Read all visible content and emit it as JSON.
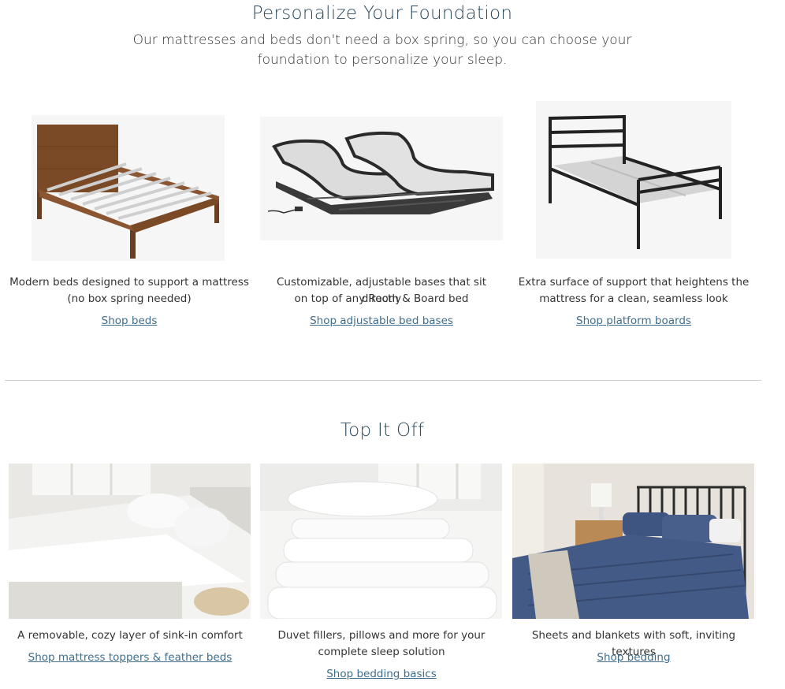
{
  "foundation": {
    "title": "Personalize Your Foundation",
    "subtitle": "Our mattresses and beds don't need a box spring, so you can choose your foundation to personalize your sleep.",
    "items": [
      {
        "desc_line1": "Modern beds designed to support a mattress",
        "desc_line2": "(no box spring needed)",
        "link": "Shop beds",
        "image_icon": "wood-bed-frame"
      },
      {
        "desc_line1": "Customizable, adjustable bases that sit directly",
        "desc_line2": "on top of any Room & Board bed",
        "link": "Shop adjustable bed bases",
        "image_icon": "adjustable-base"
      },
      {
        "desc_line1": "Extra surface of support that heightens the",
        "desc_line2": "mattress for a clean, seamless look",
        "link": "Shop platform boards",
        "image_icon": "metal-bed-frame"
      }
    ]
  },
  "top_it_off": {
    "title": "Top It Off",
    "items": [
      {
        "desc_line1": "A removable, cozy layer of sink-in comfort",
        "desc_line2": "",
        "link": "Shop mattress toppers & feather beds",
        "image_icon": "white-bedding-photo"
      },
      {
        "desc_line1": "Duvet fillers, pillows and more for your",
        "desc_line2": "complete sleep solution",
        "link": "Shop bedding basics",
        "image_icon": "duvet-stack-photo"
      },
      {
        "desc_line1": "Sheets and blankets with soft, inviting textures",
        "desc_line2": "",
        "link": "Shop bedding",
        "image_icon": "blue-bedding-photo"
      }
    ]
  }
}
